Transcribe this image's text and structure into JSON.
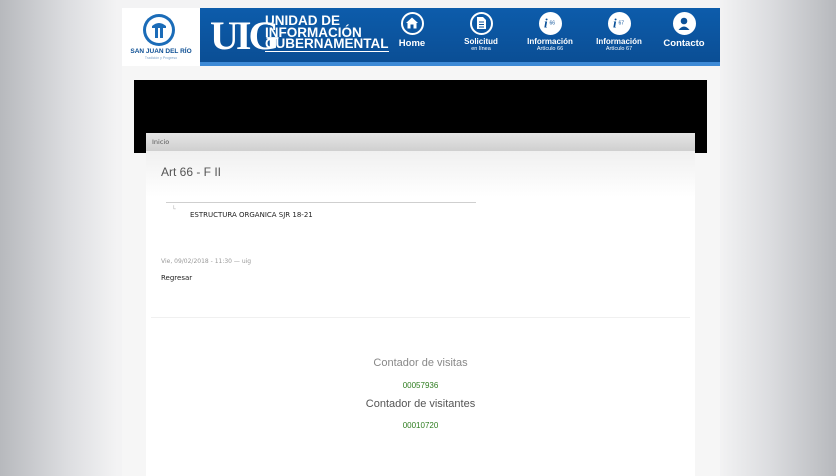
{
  "header": {
    "logo_name": "SAN JUAN DEL RÍO",
    "logo_tagline": "Tradición y Progreso",
    "uig_mark": "UIG",
    "uig_line1": "UNIDAD DE",
    "uig_line2": "INFORMACIÓN",
    "uig_line3": "GUBERNAMENTAL",
    "nav": [
      {
        "label": "Home",
        "sub": "",
        "icon": "home-icon"
      },
      {
        "label": "Solicitud",
        "sub": "en línea",
        "icon": "document-icon"
      },
      {
        "label": "Información",
        "sub": "Artículo 66",
        "icon": "info-66-icon"
      },
      {
        "label": "Información",
        "sub": "Artículo 67",
        "icon": "info-67-icon"
      },
      {
        "label": "Contacto",
        "sub": "",
        "icon": "person-icon"
      }
    ],
    "colors": {
      "primary": "#0a4d93",
      "stripe": "#3d8ad6"
    }
  },
  "content": {
    "breadcrumb": "Inicio",
    "title": "Art 66 - F II",
    "attachment": "ESTRUCTURA ORGANICA SJR 18-21",
    "meta": "Vie, 09/02/2018 - 11:30 — uig",
    "back_link": "Regresar"
  },
  "counters": {
    "visits_label": "Contador de visitas",
    "visits_value": "00057936",
    "visitors_label": "Contador de visitantes",
    "visitors_value": "00010720",
    "value_color": "#2e7d1f"
  }
}
